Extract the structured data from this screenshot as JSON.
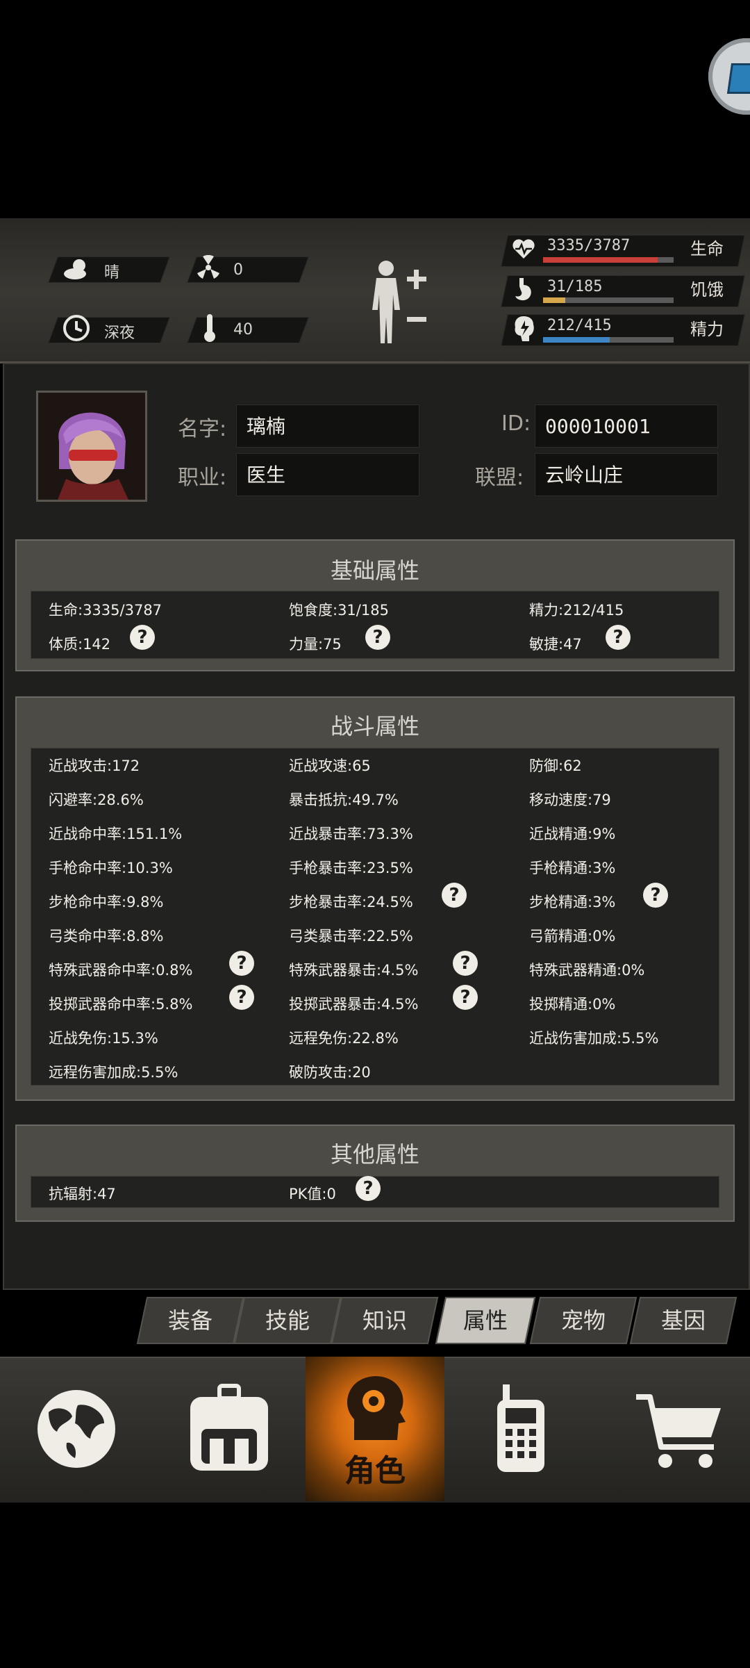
{
  "status": {
    "weather": "晴",
    "radiation": "0",
    "time": "深夜",
    "temperature": "40",
    "life": {
      "value": "3335/3787",
      "label": "生命",
      "fraction": 0.88,
      "color": "#c9403a"
    },
    "hunger": {
      "value": "31/185",
      "label": "饥饿",
      "fraction": 0.17,
      "color": "#d6a64a"
    },
    "energy": {
      "value": "212/415",
      "label": "精力",
      "fraction": 0.51,
      "color": "#3d86c6"
    }
  },
  "profile": {
    "name_label": "名字:",
    "name": "璃楠",
    "job_label": "职业:",
    "job": "医生",
    "id_label": "ID:",
    "id": "000010001",
    "alliance_label": "联盟:",
    "alliance": "云岭山庄"
  },
  "basic": {
    "title": "基础属性",
    "items": [
      "生命:3335/3787",
      "饱食度:31/185",
      "精力:212/415",
      "体质:142",
      "力量:75",
      "敏捷:47"
    ]
  },
  "combat": {
    "title": "战斗属性",
    "items": [
      "近战攻击:172",
      "近战攻速:65",
      "防御:62",
      "闪避率:28.6%",
      "暴击抵抗:49.7%",
      "移动速度:79",
      "近战命中率:151.1%",
      "近战暴击率:73.3%",
      "近战精通:9%",
      "手枪命中率:10.3%",
      "手枪暴击率:23.5%",
      "手枪精通:3%",
      "步枪命中率:9.8%",
      "步枪暴击率:24.5%",
      "步枪精通:3%",
      "弓类命中率:8.8%",
      "弓类暴击率:22.5%",
      "弓箭精通:0%",
      "特殊武器命中率:0.8%",
      "特殊武器暴击:4.5%",
      "特殊武器精通:0%",
      "投掷武器命中率:5.8%",
      "投掷武器暴击:4.5%",
      "投掷精通:0%",
      "近战免伤:15.3%",
      "远程免伤:22.8%",
      "近战伤害加成:5.5%",
      "远程伤害加成:5.5%",
      "破防攻击:20"
    ]
  },
  "other": {
    "title": "其他属性",
    "items": [
      "抗辐射:47",
      "PK值:0"
    ]
  },
  "help_mark": "?",
  "tabs": [
    "装备",
    "技能",
    "知识",
    "属性",
    "宠物",
    "基因"
  ],
  "active_tab": "属性",
  "nav": {
    "role_label": "角色"
  }
}
